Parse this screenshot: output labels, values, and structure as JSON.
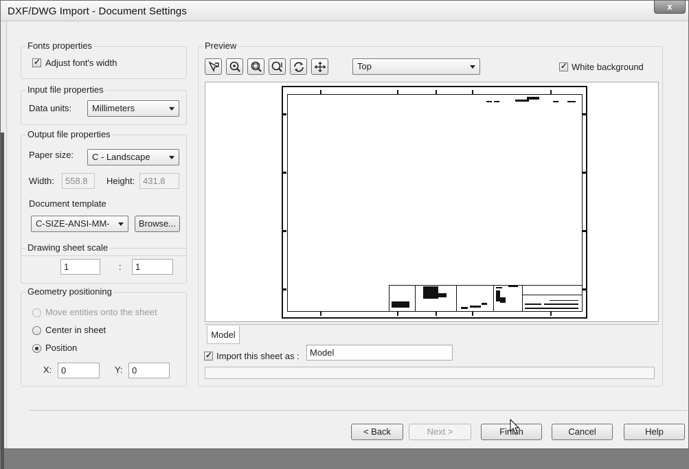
{
  "window": {
    "title": "DXF/DWG Import - Document Settings",
    "close_label": "x"
  },
  "fonts": {
    "group_label": "Fonts properties",
    "adjust_width_label": "Adjust font's width",
    "adjust_width_checked": true
  },
  "input_file": {
    "group_label": "Input file properties",
    "data_units_label": "Data units:",
    "data_units_value": "Millimeters"
  },
  "output_file": {
    "group_label": "Output file properties",
    "paper_size_label": "Paper size:",
    "paper_size_value": "C - Landscape",
    "width_label": "Width:",
    "width_value": "558.8",
    "height_label": "Height:",
    "height_value": "431.8",
    "template_label": "Document template",
    "template_value": "C-SIZE-ANSI-MM-",
    "browse_label": "Browse..."
  },
  "scale": {
    "group_label": "Drawing sheet scale",
    "left": "1",
    "separator": ":",
    "right": "1"
  },
  "geometry": {
    "group_label": "Geometry positioning",
    "options": [
      "Move entities onto the sheet",
      "Center in sheet",
      "Position"
    ],
    "selected": "Position",
    "x_label": "X:",
    "x_value": "0",
    "y_label": "Y:",
    "y_value": "0"
  },
  "preview": {
    "group_label": "Preview",
    "view_value": "Top",
    "white_bg_label": "White background",
    "white_bg_checked": true,
    "tools": [
      "select-tool-icon",
      "zoom-icon",
      "zoom-window-icon",
      "zoom-extents-icon",
      "rotate-icon",
      "pan-icon"
    ]
  },
  "sheet": {
    "tab_label": "Model",
    "import_label": "Import this sheet as :",
    "import_checked": true,
    "import_value": "Model"
  },
  "buttons": {
    "back": "< Back",
    "next": "Next >",
    "finish": "Finish",
    "cancel": "Cancel",
    "help": "Help"
  }
}
